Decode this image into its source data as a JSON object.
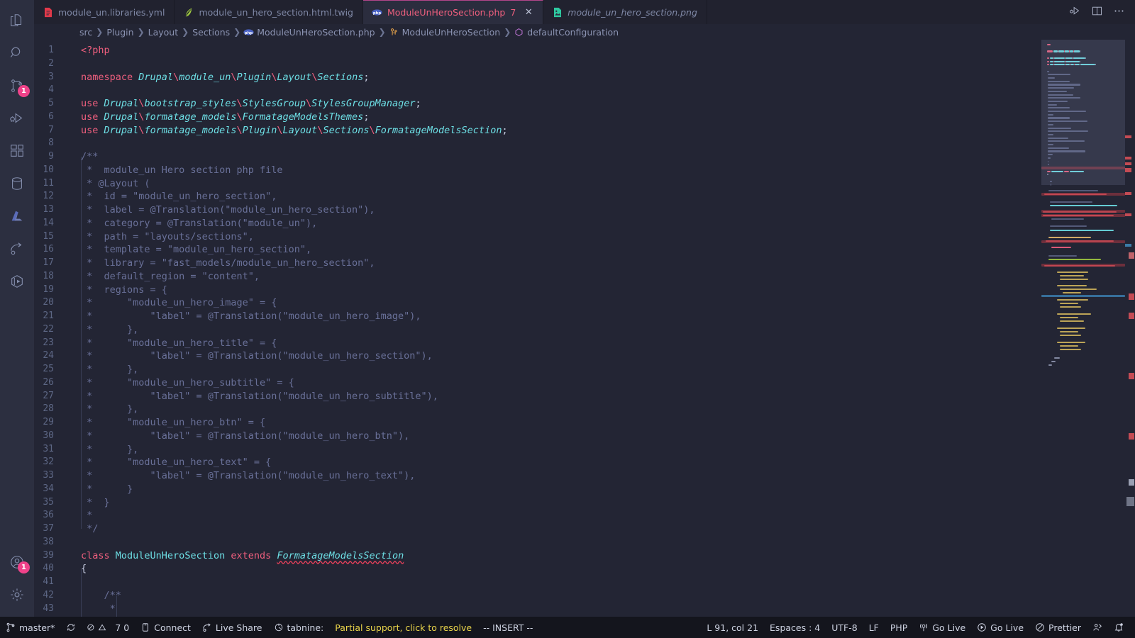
{
  "activitybar": {
    "items": [
      {
        "name": "explorer",
        "icon": "files-icon",
        "badge": null
      },
      {
        "name": "search",
        "icon": "search-icon",
        "badge": null
      },
      {
        "name": "source-control",
        "icon": "source-control-icon",
        "badge": "1"
      },
      {
        "name": "run-and-debug",
        "icon": "run-debug-icon",
        "badge": null
      },
      {
        "name": "extensions",
        "icon": "extensions-icon",
        "badge": null
      },
      {
        "name": "database",
        "icon": "database-icon",
        "badge": null
      },
      {
        "name": "azure",
        "icon": "azure-icon",
        "badge": null
      },
      {
        "name": "live-share",
        "icon": "live-share-icon",
        "badge": null
      },
      {
        "name": "remote-explorer",
        "icon": "cube-icon",
        "badge": null
      }
    ],
    "bottom": [
      {
        "name": "accounts",
        "icon": "account-icon",
        "badge": "1"
      },
      {
        "name": "manage",
        "icon": "gear-icon",
        "badge": null
      }
    ]
  },
  "tabs": [
    {
      "label": "module_un.libraries.yml",
      "icon": "yaml-file-icon",
      "icon_color": "#e3394a",
      "active": false,
      "preview": false,
      "badge": "",
      "closable": false
    },
    {
      "label": "module_un_hero_section.html.twig",
      "icon": "twig-file-icon",
      "icon_color": "#9ec840",
      "active": false,
      "preview": false,
      "badge": "",
      "closable": false
    },
    {
      "label": "ModuleUnHeroSection.php",
      "icon": "php-file-icon",
      "icon_color": "#4a62c4",
      "active": true,
      "preview": false,
      "badge": "7",
      "closable": true
    },
    {
      "label": "module_un_hero_section.png",
      "icon": "image-file-icon",
      "icon_color": "#2ec9a0",
      "active": false,
      "preview": true,
      "badge": "",
      "closable": false
    }
  ],
  "tabbar_actions": [
    {
      "name": "run-or-debug-icon",
      "label": ""
    },
    {
      "name": "split-editor-icon",
      "label": ""
    },
    {
      "name": "more-actions-icon",
      "label": ""
    }
  ],
  "breadcrumb": [
    {
      "label": "src",
      "icon": ""
    },
    {
      "label": "Plugin",
      "icon": ""
    },
    {
      "label": "Layout",
      "icon": ""
    },
    {
      "label": "Sections",
      "icon": ""
    },
    {
      "label": "ModuleUnHeroSection.php",
      "icon": "php-file-icon"
    },
    {
      "label": "ModuleUnHeroSection",
      "icon": "symbol-class-icon"
    },
    {
      "label": "defaultConfiguration",
      "icon": "symbol-method-icon"
    }
  ],
  "editor": {
    "first_line": 1,
    "lines": [
      {
        "n": 1,
        "tokens": [
          {
            "t": "<?php",
            "c": "t-kw"
          }
        ]
      },
      {
        "n": 2,
        "tokens": []
      },
      {
        "n": 3,
        "tokens": [
          {
            "t": "namespace ",
            "c": "t-kw"
          },
          {
            "t": "Drupal",
            "c": "t-ns"
          },
          {
            "t": "\\",
            "c": "t-sep"
          },
          {
            "t": "module_un",
            "c": "t-ns"
          },
          {
            "t": "\\",
            "c": "t-sep"
          },
          {
            "t": "Plugin",
            "c": "t-ns"
          },
          {
            "t": "\\",
            "c": "t-sep"
          },
          {
            "t": "Layout",
            "c": "t-ns"
          },
          {
            "t": "\\",
            "c": "t-sep"
          },
          {
            "t": "Sections",
            "c": "t-ns"
          },
          {
            "t": ";",
            "c": "t-punc"
          }
        ]
      },
      {
        "n": 4,
        "tokens": []
      },
      {
        "n": 5,
        "tokens": [
          {
            "t": "use ",
            "c": "t-kw"
          },
          {
            "t": "Drupal",
            "c": "t-ns"
          },
          {
            "t": "\\",
            "c": "t-sep"
          },
          {
            "t": "bootstrap_styles",
            "c": "t-ns"
          },
          {
            "t": "\\",
            "c": "t-sep"
          },
          {
            "t": "StylesGroup",
            "c": "t-ns"
          },
          {
            "t": "\\",
            "c": "t-sep"
          },
          {
            "t": "StylesGroupManager",
            "c": "t-ns"
          },
          {
            "t": ";",
            "c": "t-punc"
          }
        ]
      },
      {
        "n": 6,
        "tokens": [
          {
            "t": "use ",
            "c": "t-kw"
          },
          {
            "t": "Drupal",
            "c": "t-ns"
          },
          {
            "t": "\\",
            "c": "t-sep"
          },
          {
            "t": "formatage_models",
            "c": "t-ns"
          },
          {
            "t": "\\",
            "c": "t-sep"
          },
          {
            "t": "FormatageModelsThemes",
            "c": "t-ns"
          },
          {
            "t": ";",
            "c": "t-punc"
          }
        ]
      },
      {
        "n": 7,
        "tokens": [
          {
            "t": "use ",
            "c": "t-kw"
          },
          {
            "t": "Drupal",
            "c": "t-ns"
          },
          {
            "t": "\\",
            "c": "t-sep"
          },
          {
            "t": "formatage_models",
            "c": "t-ns"
          },
          {
            "t": "\\",
            "c": "t-sep"
          },
          {
            "t": "Plugin",
            "c": "t-ns"
          },
          {
            "t": "\\",
            "c": "t-sep"
          },
          {
            "t": "Layout",
            "c": "t-ns"
          },
          {
            "t": "\\",
            "c": "t-sep"
          },
          {
            "t": "Sections",
            "c": "t-ns"
          },
          {
            "t": "\\",
            "c": "t-sep"
          },
          {
            "t": "FormatageModelsSection",
            "c": "t-ns"
          },
          {
            "t": ";",
            "c": "t-punc"
          }
        ]
      },
      {
        "n": 8,
        "tokens": []
      },
      {
        "n": 9,
        "tokens": [
          {
            "t": "/**",
            "c": "t-cmt"
          }
        ]
      },
      {
        "n": 10,
        "tokens": [
          {
            "t": " *  module_un Hero section php file",
            "c": "t-cmt"
          }
        ]
      },
      {
        "n": 11,
        "tokens": [
          {
            "t": " * @Layout (",
            "c": "t-cmt"
          }
        ]
      },
      {
        "n": 12,
        "tokens": [
          {
            "t": " *  id = \"module_un_hero_section\",",
            "c": "t-cmt"
          }
        ]
      },
      {
        "n": 13,
        "tokens": [
          {
            "t": " *  label = @Translation(\"module_un_hero_section\"),",
            "c": "t-cmt"
          }
        ]
      },
      {
        "n": 14,
        "tokens": [
          {
            "t": " *  category = @Translation(\"module_un\"),",
            "c": "t-cmt"
          }
        ]
      },
      {
        "n": 15,
        "tokens": [
          {
            "t": " *  path = \"layouts/sections\",",
            "c": "t-cmt"
          }
        ]
      },
      {
        "n": 16,
        "tokens": [
          {
            "t": " *  template = \"module_un_hero_section\",",
            "c": "t-cmt"
          }
        ]
      },
      {
        "n": 17,
        "tokens": [
          {
            "t": " *  library = \"fast_models/module_un_hero_section\",",
            "c": "t-cmt"
          }
        ]
      },
      {
        "n": 18,
        "tokens": [
          {
            "t": " *  default_region = \"content\",",
            "c": "t-cmt"
          }
        ]
      },
      {
        "n": 19,
        "tokens": [
          {
            "t": " *  regions = {",
            "c": "t-cmt"
          }
        ]
      },
      {
        "n": 20,
        "tokens": [
          {
            "t": " *      \"module_un_hero_image\" = {",
            "c": "t-cmt"
          }
        ]
      },
      {
        "n": 21,
        "tokens": [
          {
            "t": " *          \"label\" = @Translation(\"module_un_hero_image\"),",
            "c": "t-cmt"
          }
        ]
      },
      {
        "n": 22,
        "tokens": [
          {
            "t": " *      },",
            "c": "t-cmt"
          }
        ]
      },
      {
        "n": 23,
        "tokens": [
          {
            "t": " *      \"module_un_hero_title\" = {",
            "c": "t-cmt"
          }
        ]
      },
      {
        "n": 24,
        "tokens": [
          {
            "t": " *          \"label\" = @Translation(\"module_un_hero_section\"),",
            "c": "t-cmt"
          }
        ]
      },
      {
        "n": 25,
        "tokens": [
          {
            "t": " *      },",
            "c": "t-cmt"
          }
        ]
      },
      {
        "n": 26,
        "tokens": [
          {
            "t": " *      \"module_un_hero_subtitle\" = {",
            "c": "t-cmt"
          }
        ]
      },
      {
        "n": 27,
        "tokens": [
          {
            "t": " *          \"label\" = @Translation(\"module_un_hero_subtitle\"),",
            "c": "t-cmt"
          }
        ]
      },
      {
        "n": 28,
        "tokens": [
          {
            "t": " *      },",
            "c": "t-cmt"
          }
        ]
      },
      {
        "n": 29,
        "tokens": [
          {
            "t": " *      \"module_un_hero_btn\" = {",
            "c": "t-cmt"
          }
        ]
      },
      {
        "n": 30,
        "tokens": [
          {
            "t": " *          \"label\" = @Translation(\"module_un_hero_btn\"),",
            "c": "t-cmt"
          }
        ]
      },
      {
        "n": 31,
        "tokens": [
          {
            "t": " *      },",
            "c": "t-cmt"
          }
        ]
      },
      {
        "n": 32,
        "tokens": [
          {
            "t": " *      \"module_un_hero_text\" = {",
            "c": "t-cmt"
          }
        ]
      },
      {
        "n": 33,
        "tokens": [
          {
            "t": " *          \"label\" = @Translation(\"module_un_hero_text\"),",
            "c": "t-cmt"
          }
        ]
      },
      {
        "n": 34,
        "tokens": [
          {
            "t": " *      }",
            "c": "t-cmt"
          }
        ]
      },
      {
        "n": 35,
        "tokens": [
          {
            "t": " *  }",
            "c": "t-cmt"
          }
        ]
      },
      {
        "n": 36,
        "tokens": [
          {
            "t": " *",
            "c": "t-cmt"
          }
        ]
      },
      {
        "n": 37,
        "tokens": [
          {
            "t": " */",
            "c": "t-cmt"
          }
        ]
      },
      {
        "n": 38,
        "tokens": []
      },
      {
        "n": 39,
        "tokens": [
          {
            "t": "class ",
            "c": "t-kw"
          },
          {
            "t": "ModuleUnHeroSection",
            "c": "t-class"
          },
          {
            "t": " ",
            "c": "t-punc"
          },
          {
            "t": "extends",
            "c": "t-kw"
          },
          {
            "t": " ",
            "c": "t-punc"
          },
          {
            "t": "FormatageModelsSection",
            "c": "t-ext"
          }
        ]
      },
      {
        "n": 40,
        "tokens": [
          {
            "t": "{",
            "c": "t-punc"
          }
        ]
      },
      {
        "n": 41,
        "tokens": []
      },
      {
        "n": 42,
        "tokens": [
          {
            "t": "    /**",
            "c": "t-cmt"
          }
        ]
      },
      {
        "n": 43,
        "tokens": [
          {
            "t": "     *",
            "c": "t-cmt"
          }
        ]
      }
    ]
  },
  "statusbar": {
    "left": [
      {
        "name": "remote-branch",
        "icon": "git-branch-icon",
        "label": "master*"
      },
      {
        "name": "sync-changes",
        "icon": "sync-icon",
        "label": ""
      },
      {
        "name": "problems",
        "icon": "error-warning-icon",
        "label": "7  0"
      },
      {
        "name": "connect",
        "icon": "remote-icon",
        "label": "Connect"
      },
      {
        "name": "live-share",
        "icon": "live-share-icon",
        "label": "Live Share"
      },
      {
        "name": "tabnine",
        "icon": "tabnine-icon",
        "label": "tabnine:"
      },
      {
        "name": "tabnine-status",
        "icon": "",
        "label": "Partial support, click to resolve",
        "warn": true
      },
      {
        "name": "vim-mode",
        "icon": "",
        "label": "-- INSERT --"
      }
    ],
    "right": [
      {
        "name": "cursor-position",
        "icon": "",
        "label": "L 91, col 21"
      },
      {
        "name": "indentation",
        "icon": "",
        "label": "Espaces : 4"
      },
      {
        "name": "encoding",
        "icon": "",
        "label": "UTF-8"
      },
      {
        "name": "eol",
        "icon": "",
        "label": "LF"
      },
      {
        "name": "language-mode",
        "icon": "",
        "label": "PHP"
      },
      {
        "name": "go-live-server",
        "icon": "broadcast-icon",
        "label": "Go Live"
      },
      {
        "name": "go-live-preview",
        "icon": "play-circle-icon",
        "label": "Go Live"
      },
      {
        "name": "prettier",
        "icon": "prettier-icon",
        "label": "Prettier"
      },
      {
        "name": "feedback",
        "icon": "feedback-icon",
        "label": ""
      },
      {
        "name": "notifications",
        "icon": "bell-dot-icon",
        "label": ""
      }
    ]
  },
  "colors": {
    "editor_background": "#232534",
    "activitybar_background": "#2c2f40",
    "tabbar_background": "#21222f",
    "active_tab_background": "#2b2d3e",
    "active_tab_border": "#b2468a",
    "statusbar_background": "#14151d",
    "keyword": "#ef5f7e",
    "namespace": "#6ddfe5",
    "comment": "#697098",
    "linenumber": "#5d6785",
    "badge": "#f0428a",
    "error": "#e8405a",
    "warn_text": "#e9d44a"
  }
}
